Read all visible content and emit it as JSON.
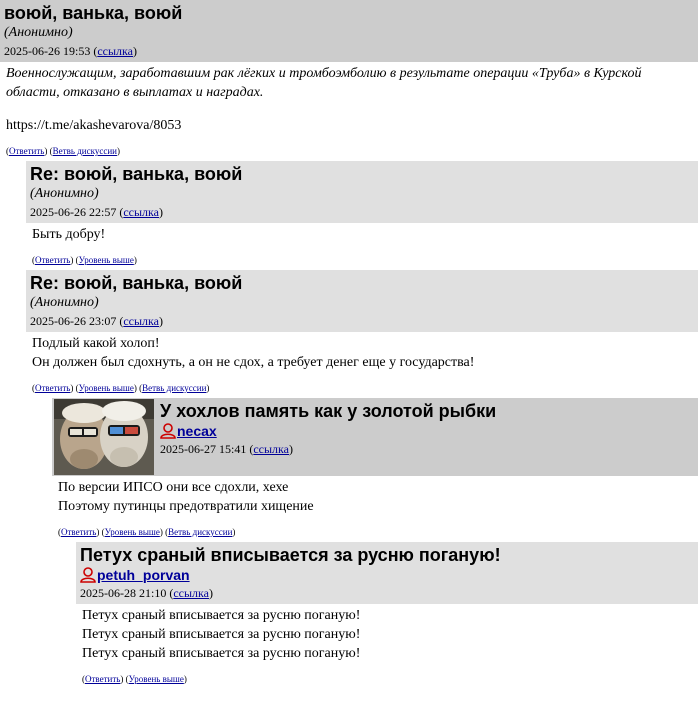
{
  "comments": [
    {
      "title": "воюй, ванька, воюй",
      "author": "(Анонимно)",
      "date": "2025-06-26 19:53",
      "link_label": "ссылка",
      "body_italic": "Военнослужащим, заработавшим рак лёгких и тромбоэмболию в результате операции «Труба» в Курской области, отказано в выплатах и наградах.",
      "body_url": "https://t.me/akashevarova/8053",
      "actions": {
        "reply": "Ответить",
        "thread": "Ветвь дискуссии"
      }
    },
    {
      "title": "Re: воюй, ванька, воюй",
      "author": "(Анонимно)",
      "date": "2025-06-26 22:57",
      "link_label": "ссылка",
      "body_lines": [
        "Быть добру!"
      ],
      "actions": {
        "reply": "Ответить",
        "up": "Уровень выше"
      }
    },
    {
      "title": "Re: воюй, ванька, воюй",
      "author": "(Анонимно)",
      "date": "2025-06-26 23:07",
      "link_label": "ссылка",
      "body_lines": [
        "Подлый какой холоп!",
        "Он должен был сдохнуть, а он не сдох, а требует денег еще у государства!"
      ],
      "actions": {
        "reply": "Ответить",
        "up": "Уровень выше",
        "thread": "Ветвь дискуссии"
      }
    },
    {
      "title": "У хохлов память как у золотой рыбки",
      "author": "necax",
      "date": "2025-06-27 15:41",
      "link_label": "ссылка",
      "body_lines": [
        "По версии ИПСО они все сдохли, хехе",
        "Поэтому путинцы предотвратили хищение"
      ],
      "actions": {
        "reply": "Ответить",
        "up": "Уровень выше",
        "thread": "Ветвь дискуссии"
      }
    },
    {
      "title": "Петух сраный вписывается за русню поганую!",
      "author": "petuh_porvan",
      "date": "2025-06-28 21:10",
      "link_label": "ссылка",
      "body_lines": [
        "Петух сраный вписывается за русню поганую!",
        "Петух сраный вписывается за русню поганую!",
        "Петух сраный вписывается за русню поганую!"
      ],
      "actions": {
        "reply": "Ответить",
        "up": "Уровень выше"
      }
    }
  ],
  "colors": {
    "header_dark": "#cccccc",
    "header_light": "#e0e0e0",
    "link": "#000099",
    "user_icon": "#cc0000"
  },
  "icons": {
    "user": "user-icon",
    "avatar": "avatar-image"
  }
}
